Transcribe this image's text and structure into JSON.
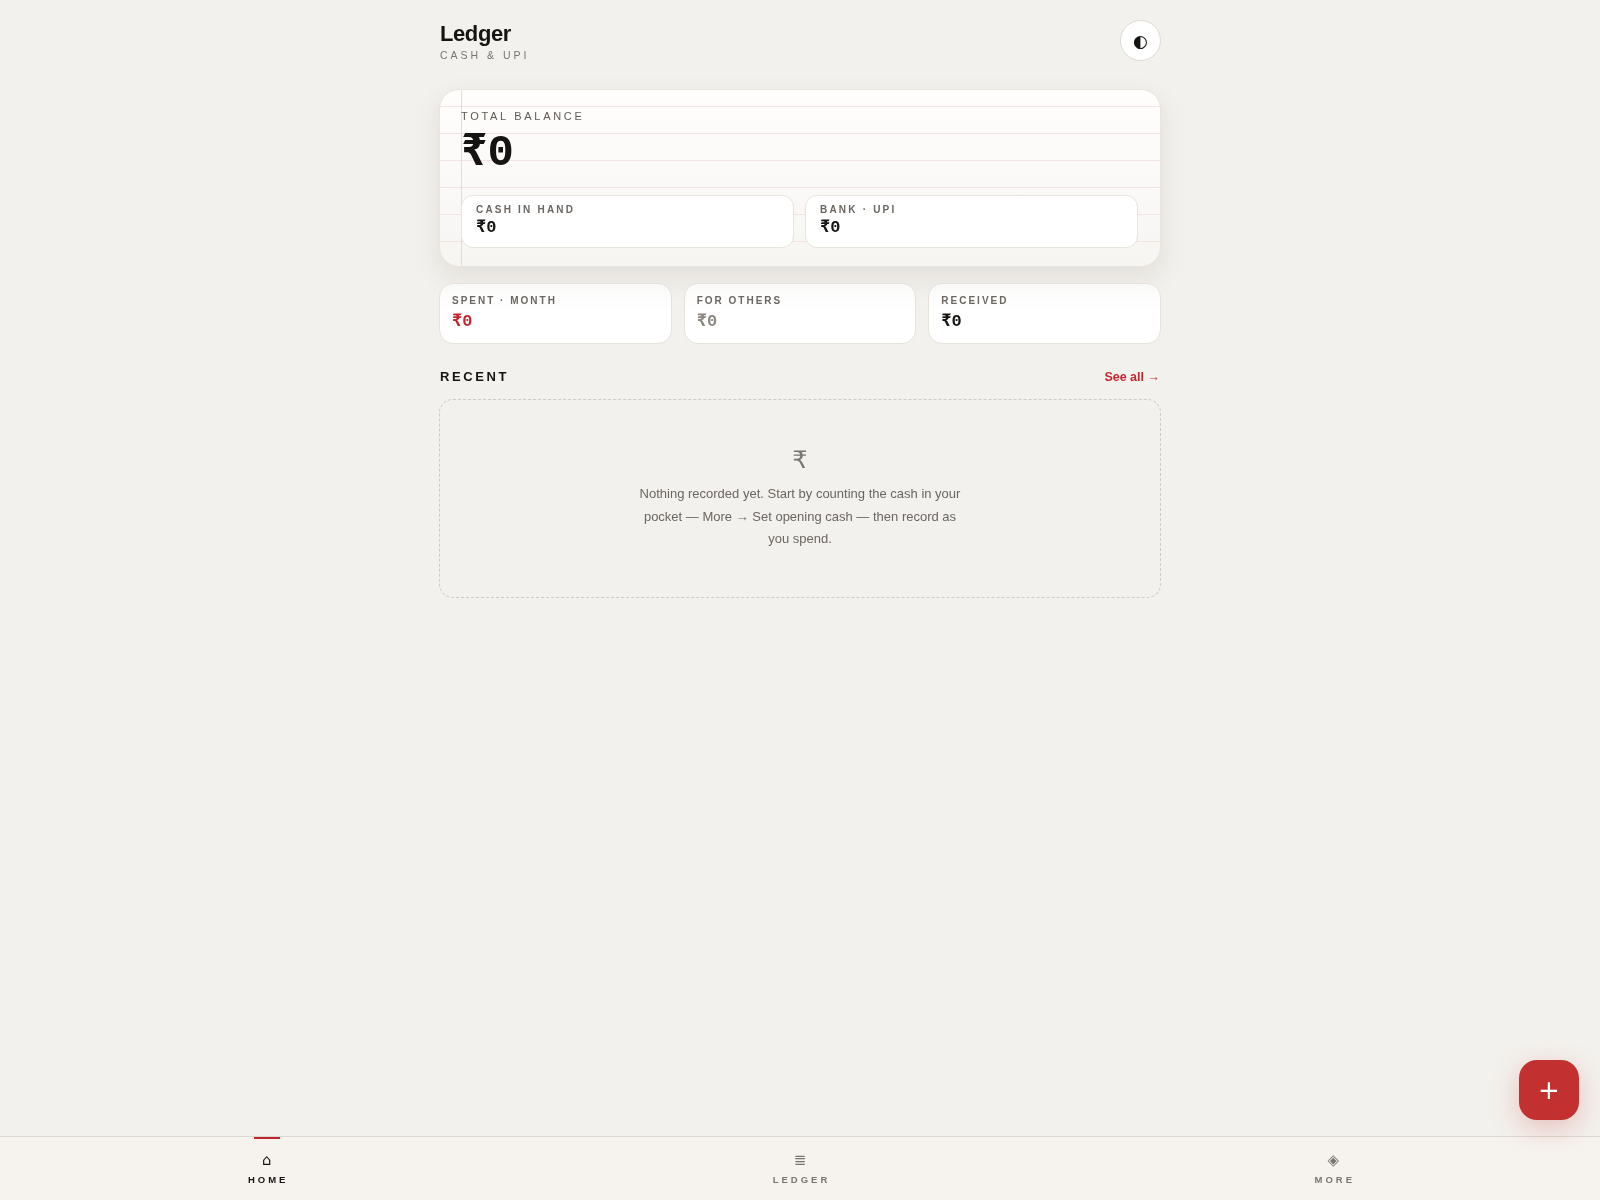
{
  "header": {
    "title": "Ledger",
    "subtitle": "CASH & UPI",
    "theme_icon": "◐"
  },
  "balance": {
    "label": "TOTAL BALANCE",
    "amount": "₹0",
    "accounts": [
      {
        "label": "CASH IN HAND",
        "amount": "₹0"
      },
      {
        "label": "BANK · UPI",
        "amount": "₹0"
      }
    ]
  },
  "stats": [
    {
      "label": "SPENT · MONTH",
      "amount": "₹0",
      "color": "#c0282d"
    },
    {
      "label": "FOR OTHERS",
      "amount": "₹0",
      "color": "#8c8781"
    },
    {
      "label": "RECEIVED",
      "amount": "₹0",
      "color": "#161412"
    }
  ],
  "recent": {
    "title": "RECENT",
    "see_all": "See all →",
    "empty_icon": "₹",
    "empty_message": "Nothing recorded yet. Start by counting the cash in your pocket — More → Set opening cash — then record as you spend."
  },
  "nav": [
    {
      "label": "HOME",
      "icon": "⌂",
      "selected": true
    },
    {
      "label": "LEDGER",
      "icon": "≣",
      "selected": false
    },
    {
      "label": "MORE",
      "icon": "◈",
      "selected": false
    }
  ],
  "fab": {
    "label": "+"
  }
}
